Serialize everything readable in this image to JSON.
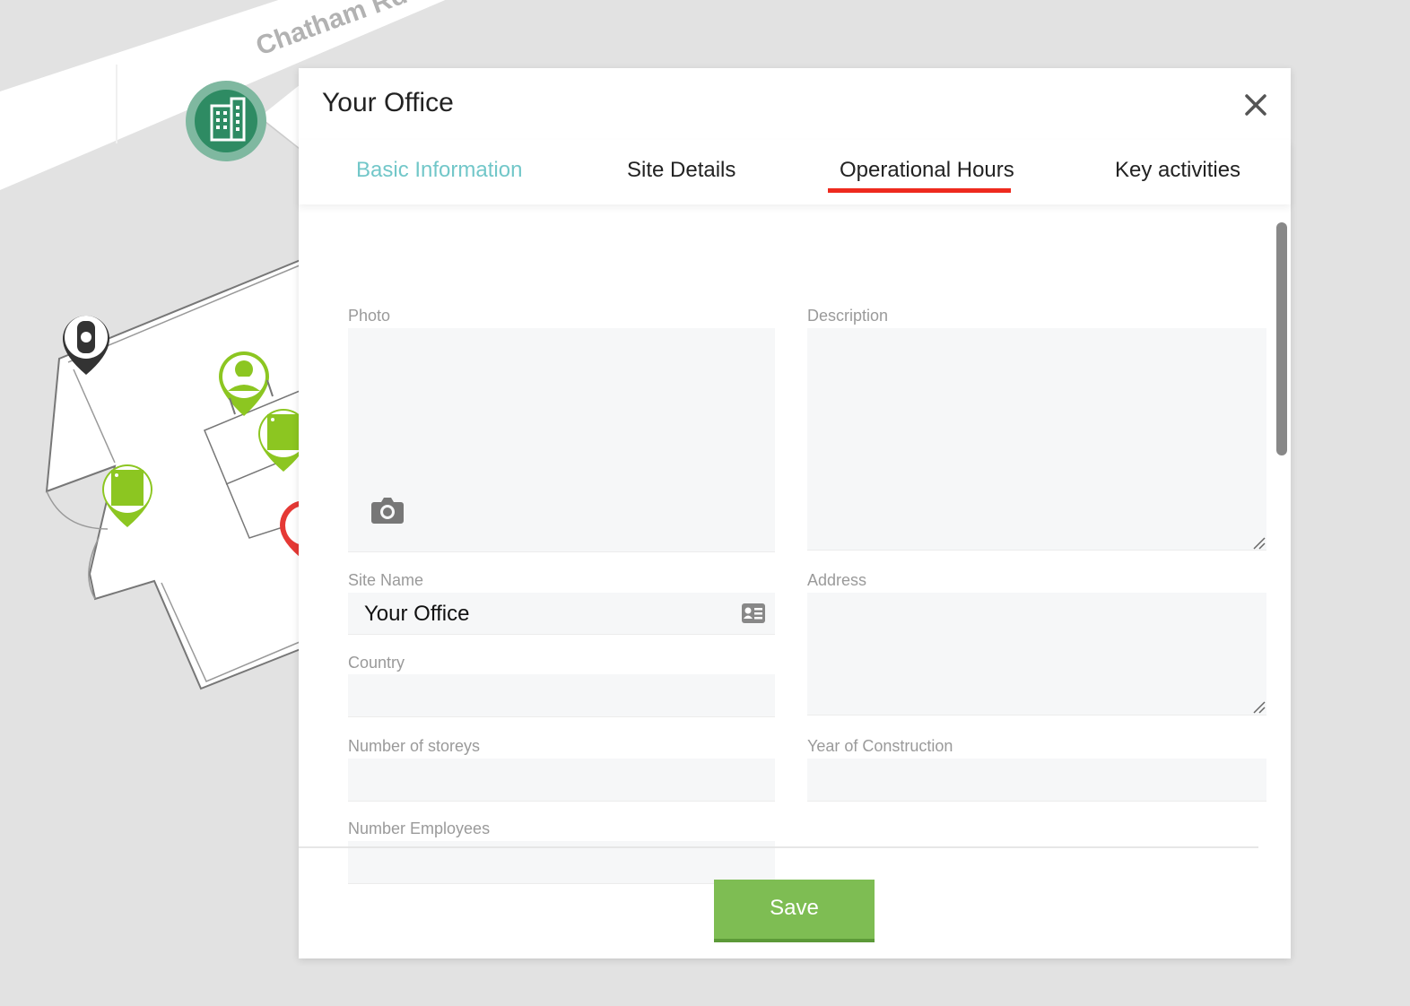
{
  "map": {
    "street_name": "Chatham Rd"
  },
  "modal": {
    "title": "Your Office",
    "close_icon": "close-icon",
    "tabs": [
      {
        "label": "Basic Information",
        "state": "link"
      },
      {
        "label": "Site Details",
        "state": "normal"
      },
      {
        "label": "Operational Hours",
        "state": "active"
      },
      {
        "label": "Key activities",
        "state": "normal"
      }
    ]
  },
  "form": {
    "photo": {
      "label": "Photo",
      "icon": "camera-icon"
    },
    "description": {
      "label": "Description",
      "value": ""
    },
    "site_name": {
      "label": "Site Name",
      "value": "Your Office",
      "icon": "contact-card-icon"
    },
    "address": {
      "label": "Address",
      "value": ""
    },
    "country": {
      "label": "Country",
      "value": ""
    },
    "number_of_storeys": {
      "label": "Number of storeys",
      "value": ""
    },
    "year_of_construction": {
      "label": "Year of Construction",
      "value": ""
    },
    "number_employees": {
      "label": "Number Employees",
      "value": ""
    }
  },
  "footer": {
    "save_label": "Save"
  },
  "colors": {
    "tab_link": "#72c7c9",
    "tab_active_underline": "#ee2a1e",
    "save_button": "#7ebd53",
    "marker_green": "#8cc621",
    "building_marker": "#2e8b63"
  }
}
